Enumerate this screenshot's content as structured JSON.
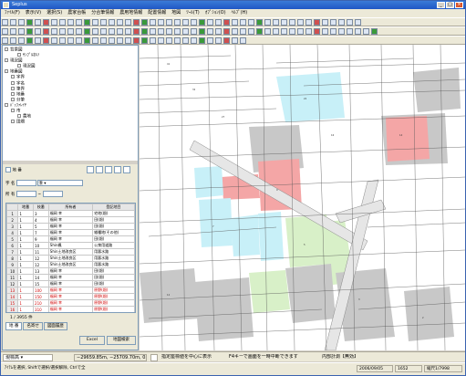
{
  "window": {
    "title": "Seplus"
  },
  "menu": [
    "ﾌｧｲﾙ(F)",
    "表示(V)",
    "選択(S)",
    "農家台帳",
    "分合筆情報",
    "農用地情報",
    "配置情報",
    "地図",
    "ﾂｰﾙ(T)",
    "ｵﾌﾟｼｮﾝ(O)",
    "ﾍﾙﾌﾟ(H)"
  ],
  "tree": [
    {
      "label": "背景図",
      "level": 0
    },
    {
      "label": "ｻﾝﾌﾟﾙｵﾙｿ",
      "level": 2
    },
    {
      "label": "現況図",
      "level": 0
    },
    {
      "label": "現況図",
      "level": 2
    },
    {
      "label": "地番図",
      "level": 0
    },
    {
      "label": "字界",
      "level": 1
    },
    {
      "label": "字名",
      "level": 1
    },
    {
      "label": "筆界",
      "level": 1
    },
    {
      "label": "地番",
      "level": 1
    },
    {
      "label": "分筆",
      "level": 1
    },
    {
      "label": "ﾊﾞｯﾌｧﾚｲﾔ",
      "level": 0
    },
    {
      "label": "市",
      "level": 1
    },
    {
      "label": "農地",
      "level": 2
    },
    {
      "label": "田畑",
      "level": 1
    }
  ],
  "search": {
    "checkbox_label": "地 番",
    "field1_label": "字 名",
    "field1_value": "湊",
    "field2_label": "所 有",
    "field2_value": "",
    "field3_value": ""
  },
  "table": {
    "headers": [
      "",
      "地番",
      "枝番",
      "所有者",
      "登記地目"
    ],
    "rows": [
      {
        "n": "1",
        "a": "1",
        "b": "3",
        "c": "福岡 幸",
        "d": "宅地(畑)",
        "red": false
      },
      {
        "n": "2",
        "a": "1",
        "b": "4",
        "c": "福岡 幸",
        "d": "田(畑)",
        "red": false
      },
      {
        "n": "3",
        "a": "1",
        "b": "5",
        "c": "福岡 幸",
        "d": "田(畑)",
        "red": false
      },
      {
        "n": "4",
        "a": "1",
        "b": "7",
        "c": "福岡 幸",
        "d": "雑種地(その他)",
        "red": false
      },
      {
        "n": "5",
        "a": "1",
        "b": "9",
        "c": "福岡 幸",
        "d": "田(畑)",
        "red": false
      },
      {
        "n": "6",
        "a": "1",
        "b": "10",
        "c": "Shin楓",
        "d": "公衆用道路",
        "red": false
      },
      {
        "n": "7",
        "a": "1",
        "b": "11",
        "c": "Shin土地改良区",
        "d": "用悪水路",
        "red": false
      },
      {
        "n": "8",
        "a": "1",
        "b": "12",
        "c": "Shin土地改良区",
        "d": "用悪水路",
        "red": false
      },
      {
        "n": "9",
        "a": "1",
        "b": "12",
        "c": "Shin土地改良区",
        "d": "用悪水路",
        "red": false
      },
      {
        "n": "10",
        "a": "1",
        "b": "13",
        "c": "福岡 幸",
        "d": "田(畑)",
        "red": false
      },
      {
        "n": "11",
        "a": "1",
        "b": "14",
        "c": "福岡 幸",
        "d": "田(畑)",
        "red": false
      },
      {
        "n": "12",
        "a": "1",
        "b": "15",
        "c": "福岡 幸",
        "d": "田(畑)",
        "red": false
      },
      {
        "n": "13",
        "a": "1",
        "b": "100",
        "c": "福岡 幸",
        "d": "原野(畑)",
        "red": true
      },
      {
        "n": "14",
        "a": "1",
        "b": "150",
        "c": "福岡 幸",
        "d": "原野(畑)",
        "red": true
      },
      {
        "n": "15",
        "a": "1",
        "b": "210",
        "c": "福岡 幸",
        "d": "原野(畑)",
        "red": true
      },
      {
        "n": "16",
        "a": "1",
        "b": "310",
        "c": "福岡 幸",
        "d": "原野(畑)",
        "red": true
      },
      {
        "n": "17",
        "a": "1",
        "b": "370",
        "c": "福岡 幸",
        "d": "田(畑)",
        "red": false
      }
    ]
  },
  "count": "1 / 3955 件",
  "tabs": [
    "地 番",
    "名寄せ",
    "図面履歴"
  ],
  "buttons": {
    "excel": "Excel",
    "map": "地図検索"
  },
  "status": {
    "left_select": "現標高",
    "coords": "−29659.85m, −25709.70m, 0.00m",
    "center_label": "指定座標値を中心に表示",
    "hint": "F4キーで画面を一時中断できます",
    "mode": "内部計測【無効】",
    "date": "2006/09/05",
    "num": "1652",
    "scale": "縮尺1/7998"
  },
  "footer": "ｱｲﾃﾑを選択, Shiftで選択/選択解除, Ctrlで全"
}
